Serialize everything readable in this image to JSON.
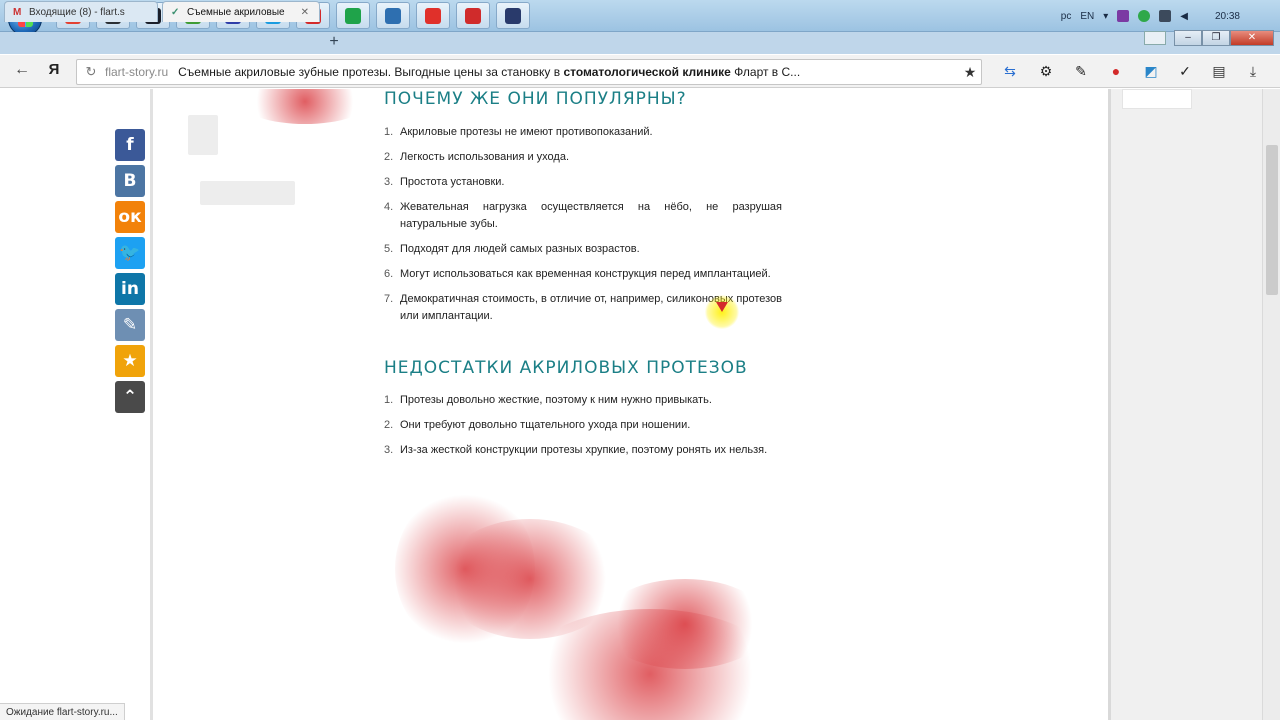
{
  "taskbar": {
    "apps": [
      {
        "icon": "chrome-icon",
        "color": "#e34133"
      },
      {
        "icon": "terminal-icon",
        "color": "#2b3035"
      },
      {
        "icon": "app-dark-icon",
        "color": "#1b1f2a"
      },
      {
        "icon": "green-app-icon",
        "color": "#3f9c35"
      },
      {
        "icon": "save-icon",
        "color": "#2f3ea8"
      },
      {
        "icon": "skype-icon",
        "color": "#1a9ce0"
      },
      {
        "icon": "pdf-icon",
        "color": "#d32a2a"
      },
      {
        "icon": "green-circle-icon",
        "color": "#1fa34a"
      },
      {
        "icon": "chat-icon",
        "color": "#2e6fb0"
      },
      {
        "icon": "yandex-y-icon",
        "color": "#e0302a"
      },
      {
        "icon": "k-icon",
        "color": "#d02b2b"
      },
      {
        "icon": "media-icon",
        "color": "#293a6b"
      }
    ],
    "tray": {
      "lang1": "pc",
      "lang2": "EN",
      "clock": "20:38"
    }
  },
  "tabs": [
    {
      "label": "Входящие (8) - flart.s",
      "favicon": "M"
    },
    {
      "label": "Съемные акриловые",
      "favicon": "✓"
    }
  ],
  "address": {
    "domain": "flart-story.ru",
    "title_plain": "Съемные акриловые зубные протезы. Выгодные цены за становку в ",
    "title_bold": "стоматологической клинике",
    "title_tail": " Фларт в С..."
  },
  "social": [
    {
      "label": "f",
      "color": "#3b5998",
      "icon": "facebook-icon"
    },
    {
      "label": "В",
      "color": "#4c75a3",
      "icon": "vk-icon"
    },
    {
      "label": "ок",
      "color": "#f2820a",
      "icon": "odnoklassniki-icon"
    },
    {
      "label": "🐦",
      "color": "#1da1f2",
      "icon": "twitter-icon"
    },
    {
      "label": "in",
      "color": "#0e76a8",
      "icon": "linkedin-icon"
    },
    {
      "label": "✎",
      "color": "#6e8fb3",
      "icon": "livejournal-icon"
    },
    {
      "label": "★",
      "color": "#f0a30a",
      "icon": "bookmark-star-icon"
    },
    {
      "label": "⌃",
      "color": "#4a4a4a",
      "icon": "more-icon"
    }
  ],
  "sections": {
    "popular": {
      "heading": "ПОЧЕМУ ЖЕ ОНИ ПОПУЛЯРНЫ?",
      "items": [
        "Акриловые протезы не имеют противопоказаний.",
        "Легкость использования и ухода.",
        "Простота установки.",
        "Жевательная нагрузка осуществляется на нёбо, не разрушая натуральные зубы.",
        "Подходят для людей самых разных возрастов.",
        "Могут использоваться как временная конструкция перед имплантацией.",
        "Демократичная стоимость, в отличие от, например, силиконовых протезов или имплантации."
      ]
    },
    "cons": {
      "heading": "НЕДОСТАТКИ АКРИЛОВЫХ ПРОТЕЗОВ",
      "items": [
        "Протезы довольно жесткие, поэтому к ним нужно привыкать.",
        "Они требуют довольно тщательного ухода при ношении.",
        "Из-за жесткой конструкции протезы хрупкие, поэтому ронять их нельзя."
      ]
    }
  },
  "status_bar": "Ожидание flart-story.ru..."
}
